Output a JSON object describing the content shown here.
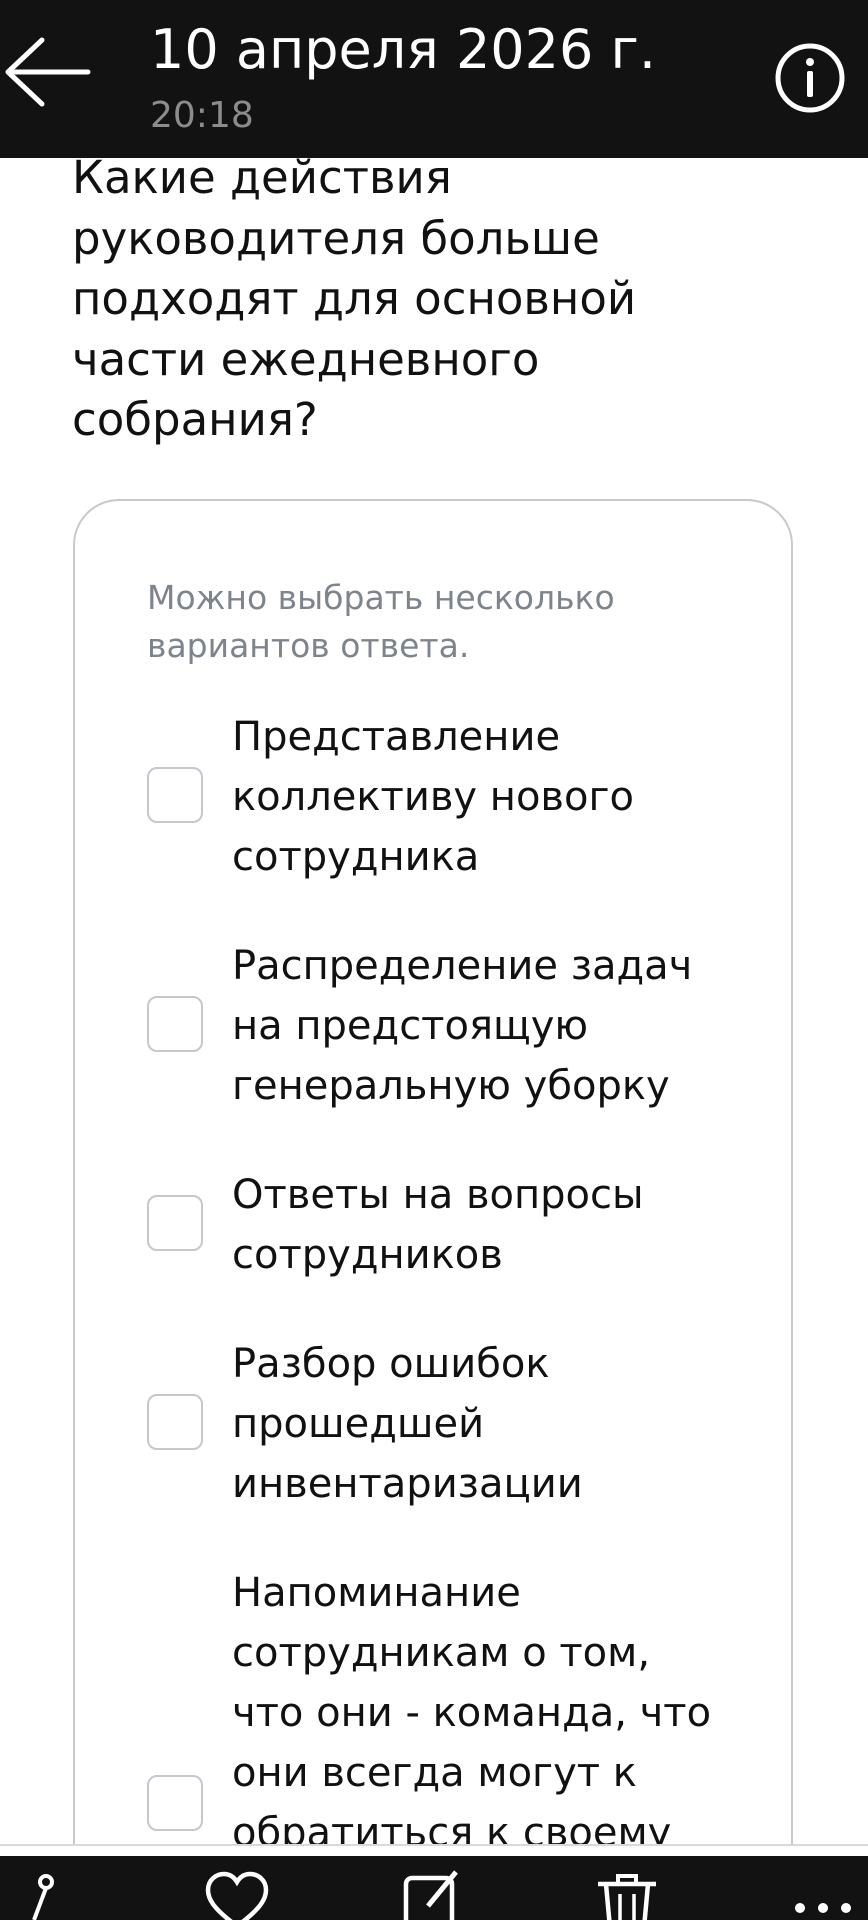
{
  "header": {
    "date": "10 апреля 2026 г.",
    "time": "20:18",
    "back_icon": "arrow-left-icon",
    "info_icon": "info-circle-icon"
  },
  "question": "Какие действия\nруководителя больше\nподходят для основной\nчасти ежедневного\nсобрания?",
  "card": {
    "hint": "Можно выбрать несколько\nвариантов ответа.",
    "options": [
      {
        "label": "Представление\nколлективу нового\nсотрудника",
        "checked": false
      },
      {
        "label": "Распределение задач\nна предстоящую\nгенеральную уборку",
        "checked": false
      },
      {
        "label": "Ответы на вопросы\nсотрудников",
        "checked": false
      },
      {
        "label": "Разбор ошибок\nпрошедшей\nинвентаризации",
        "checked": false
      },
      {
        "label": "Напоминание\nсотрудникам о том,\nчто они - команда, что\nони всегда могут к\nобратиться к своему",
        "checked": false
      }
    ]
  },
  "bottom_bar": {
    "icons": [
      "share-icon",
      "heart-icon",
      "edit-icon",
      "delete-icon",
      "more-icon"
    ]
  },
  "colors": {
    "header_bg": "#121212",
    "time_gray": "#8c8c8c",
    "hint_gray": "#7d848c",
    "border_gray": "#c7c9ce"
  }
}
